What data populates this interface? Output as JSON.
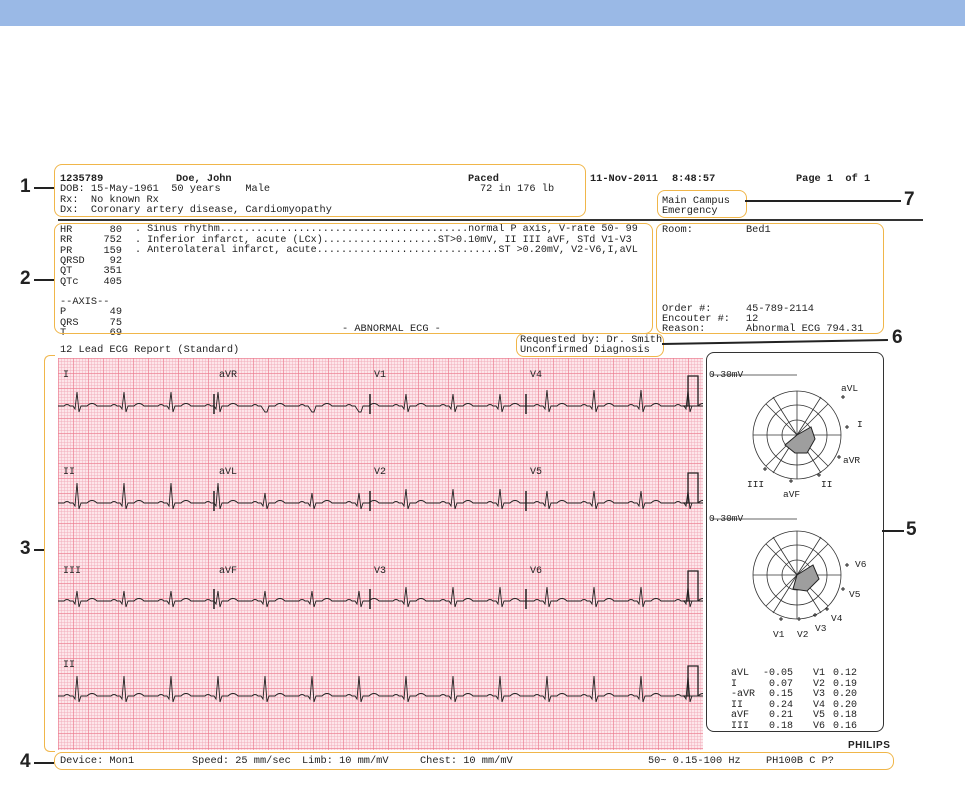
{
  "header": {
    "patient_id": "1235789",
    "patient_name": "Doe, John",
    "paced": "Paced",
    "date": "11-Nov-2011",
    "time": "8:48:57",
    "page": "Page 1  of 1",
    "dob_line": "DOB: 15-May-1961  50 years    Male",
    "height_weight": "72 in 176 lb",
    "rx_line": "Rx:  No known Rx",
    "dx_line": "Dx:  Coronary artery disease, Cardiomyopathy",
    "location_line1": "Main Campus",
    "location_line2": "Emergency"
  },
  "measurements": [
    {
      "label": "HR",
      "value": "80"
    },
    {
      "label": "RR",
      "value": "752"
    },
    {
      "label": "PR",
      "value": "159"
    },
    {
      "label": "QRSD",
      "value": "92"
    },
    {
      "label": "QT",
      "value": "351"
    },
    {
      "label": "QTc",
      "value": "405"
    },
    {
      "label": "",
      "value": ""
    },
    {
      "label": "--AXIS--",
      "value": ""
    },
    {
      "label": "P",
      "value": "49"
    },
    {
      "label": "QRS",
      "value": "75"
    },
    {
      "label": "T",
      "value": "69"
    }
  ],
  "statements": [
    ". Sinus rhythm.........................................normal P axis, V-rate 50- 99",
    ". Inferior infarct, acute (LCx)...................ST>0.10mV, II III aVF, STd V1-V3",
    ". Anterolateral infarct, acute..............................ST >0.20mV, V2-V6,I,aVL"
  ],
  "abnormal": "- ABNORMAL ECG -",
  "order": {
    "room_label": "Room:",
    "room_value": "Bed1",
    "order_label": "Order #:",
    "order_value": "45-789-2114",
    "encounter_label": "Encouter #:",
    "encounter_value": "12",
    "reason_label": "Reason:",
    "reason_value": "Abnormal ECG 794.31"
  },
  "report_title": "12 Lead ECG Report (Standard)",
  "requested_line1": "Requested by: Dr. Smith",
  "requested_line2": "Unconfirmed Diagnosis",
  "leads": {
    "r1": [
      "I",
      "aVR",
      "V1",
      "V4"
    ],
    "r2": [
      "II",
      "aVL",
      "V2",
      "V5"
    ],
    "r3": [
      "III",
      "aVF",
      "V3",
      "V6"
    ],
    "r4": [
      "II"
    ]
  },
  "axis_panel": {
    "scale1": "0.30mV",
    "scale2": "0.30mV",
    "limb_labels": [
      "aVL",
      "I",
      "aVR",
      "II",
      "aVF",
      "III"
    ],
    "chest_labels": [
      "V6",
      "V5",
      "V4",
      "V3",
      "V2",
      "V1"
    ],
    "values": [
      {
        "l1": "aVL",
        "v1": "-0.05",
        "l2": "V1",
        "v2": "0.12"
      },
      {
        "l1": "I",
        "v1": "0.07",
        "l2": "V2",
        "v2": "0.19"
      },
      {
        "l1": "-aVR",
        "v1": "0.15",
        "l2": "V3",
        "v2": "0.20"
      },
      {
        "l1": "II",
        "v1": "0.24",
        "l2": "V4",
        "v2": "0.20"
      },
      {
        "l1": "aVF",
        "v1": "0.21",
        "l2": "V5",
        "v2": "0.18"
      },
      {
        "l1": "III",
        "v1": "0.18",
        "l2": "V6",
        "v2": "0.16"
      }
    ]
  },
  "brand": "PHILIPS",
  "footer": {
    "device": "Device: Mon1",
    "speed": "Speed: 25 mm/sec",
    "limb": "Limb: 10 mm/mV",
    "chest": "Chest: 10 mm/mV",
    "filter": "50~ 0.15-100 Hz",
    "model": "PH100B C P?"
  },
  "callouts": [
    "1",
    "2",
    "3",
    "4",
    "5",
    "6",
    "7"
  ],
  "colors": {
    "topbar": "#9ab9e6",
    "highlight": "#f0b64a",
    "grid": "#fde6ea"
  }
}
